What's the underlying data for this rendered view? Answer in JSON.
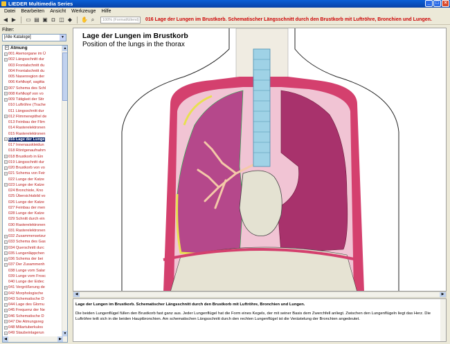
{
  "app": {
    "title": "LIEDER Multimedia Series"
  },
  "menu": [
    "Datei",
    "Bearbeiten",
    "Ansicht",
    "Werkzeuge",
    "Hilfe"
  ],
  "toolbar": {
    "zoom_value": "100% (Formatfüllend)",
    "current_path": "016 Lage der Lungen im Brustkorb. Schematischer Längsschnitt durch den Brustkorb mit Luftröhre, Bronchien und Lungen."
  },
  "filter": {
    "label": "Filter:",
    "value": "[Alle Kataloge]"
  },
  "tree": {
    "root": "Atmung",
    "items": [
      {
        "label": "001 Atemorgane im Ü",
        "exp": true
      },
      {
        "label": "002 Längsschnitt dur",
        "exp": true
      },
      {
        "label": "003 Frontalschnitt du",
        "exp": false
      },
      {
        "label": "004 Frontalschnitt du",
        "exp": false
      },
      {
        "label": "005 Nasenregion der",
        "exp": false
      },
      {
        "label": "006 Kehlkopf, sagitta",
        "exp": false
      },
      {
        "label": "007 Schema des Schl",
        "exp": true
      },
      {
        "label": "008 Kehlkopf von vo",
        "exp": true
      },
      {
        "label": "009 Tätigkeit der Stir",
        "exp": true
      },
      {
        "label": "010 Luftröhre (Trache",
        "exp": false
      },
      {
        "label": "011 Längsschnitt dur",
        "exp": false
      },
      {
        "label": "012 Flimmerepithel de",
        "exp": true
      },
      {
        "label": "013 Feinbau der Flim",
        "exp": false
      },
      {
        "label": "014 Rasterelektronen",
        "exp": false
      },
      {
        "label": "015 Rasterelektronen",
        "exp": false
      },
      {
        "label": "016 Lage der Lunge",
        "exp": true,
        "sel": true
      },
      {
        "label": "017 Innenauskleidun",
        "exp": false
      },
      {
        "label": "018 Röntgenaufnahm",
        "exp": false
      },
      {
        "label": "018 Brustkorb in Ein",
        "exp": true
      },
      {
        "label": "019 Längsschnitt dur",
        "exp": true
      },
      {
        "label": "020 Brustkorb von vo",
        "exp": true
      },
      {
        "label": "021 Schema von Feir",
        "exp": true
      },
      {
        "label": "022 Lunge der Katze",
        "exp": false
      },
      {
        "label": "023 Lunge der Katze",
        "exp": true
      },
      {
        "label": "024 Bronchiole, Kno",
        "exp": false
      },
      {
        "label": "025 Übersichtsbild vo",
        "exp": false
      },
      {
        "label": "026 Lunge der Katze",
        "exp": false
      },
      {
        "label": "027 Feinbau der men",
        "exp": false
      },
      {
        "label": "028 Lunge der Katze",
        "exp": false
      },
      {
        "label": "029 Schnitt durch ein",
        "exp": false
      },
      {
        "label": "030 Rasterelektronen",
        "exp": false
      },
      {
        "label": "031 Rasterelektronen",
        "exp": false
      },
      {
        "label": "032 Zusammensetzur",
        "exp": true
      },
      {
        "label": "033 Schema des Gas",
        "exp": true
      },
      {
        "label": "034 Querschnitt durc",
        "exp": true
      },
      {
        "label": "035 Lungenläppchen",
        "exp": true
      },
      {
        "label": "036 Schema der bei",
        "exp": true
      },
      {
        "label": "037 Der Zusammenh",
        "exp": true
      },
      {
        "label": "038 Lunge vom Salar",
        "exp": false
      },
      {
        "label": "039 Lunge vom Frosc",
        "exp": false
      },
      {
        "label": "040 Lunge der Eidec",
        "exp": false
      },
      {
        "label": "041 Vergrößerung de",
        "exp": true
      },
      {
        "label": "042 Morphologische",
        "exp": true
      },
      {
        "label": "043 Schematische D",
        "exp": true
      },
      {
        "label": "044 Lage des Glomu",
        "exp": true
      },
      {
        "label": "045 Frequenz der Ne",
        "exp": true
      },
      {
        "label": "046 Schematische D",
        "exp": true
      },
      {
        "label": "047 Die Atmungsreg",
        "exp": true
      },
      {
        "label": "048 Miliartuberkulos",
        "exp": true
      },
      {
        "label": "049 Staubeinlagerun",
        "exp": true
      }
    ]
  },
  "image": {
    "title": "Lage der Lungen im Brustkorb",
    "subtitle": "Position of the lungs in the thorax"
  },
  "description": {
    "caption": "Lage der Lungen im Brustkorb. Schematischer Längsschnitt durch den Brustkorb mit Luftröhre, Bronchien und Lungen.",
    "body": "Die beiden Lungenflügel füllen den Brustkorb fast ganz aus. Jeder Lungenflügel hat die Form eines Kegels, der mit seiner Basis dem Zwerchfell anliegt. Zwischen den Lungenflügeln liegt das Herz. Die Luftröhre teilt sich in die beiden Hauptbronchien. Am schematischen Längsschnitt durch den rechten Lungenflügel ist die Verästelung der Bronchien angedeutet."
  }
}
